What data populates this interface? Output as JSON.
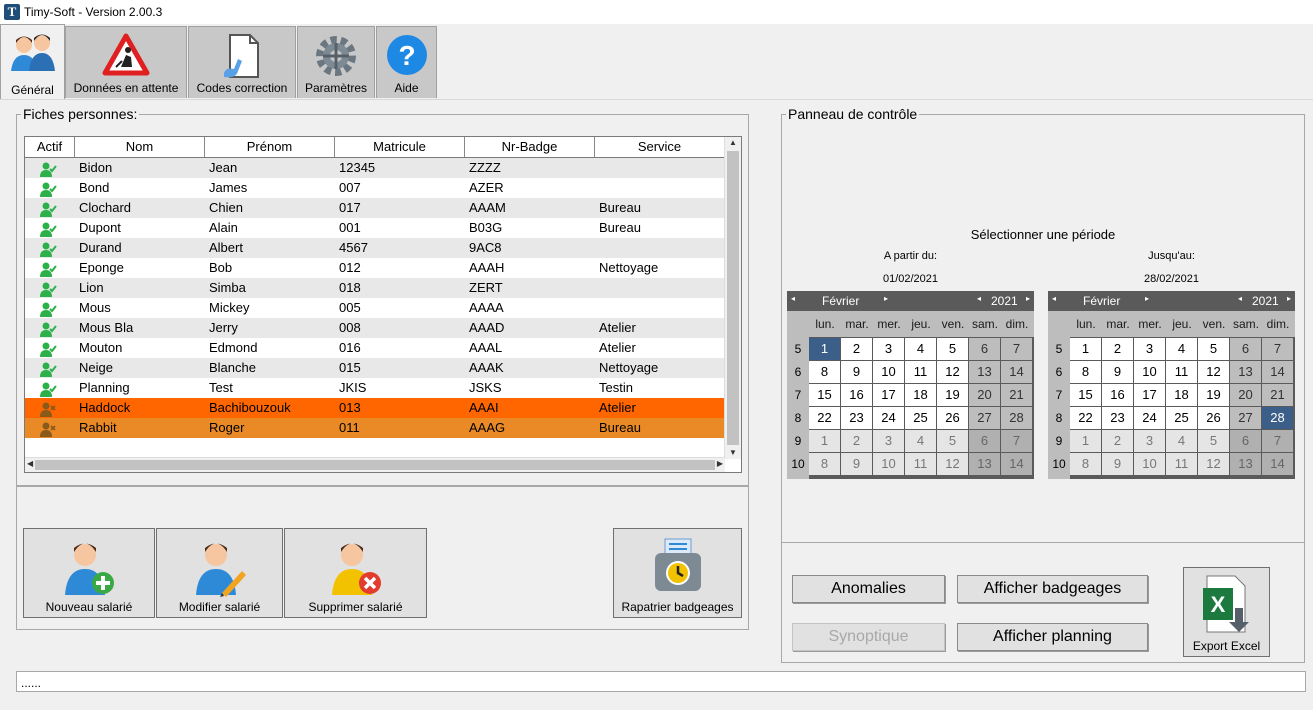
{
  "window": {
    "title": "Timy-Soft - Version 2.00.3"
  },
  "tabs": [
    {
      "label": "Général",
      "icon": "users-icon"
    },
    {
      "label": "Données en attente",
      "icon": "roadwork-warning-icon"
    },
    {
      "label": "Codes correction",
      "icon": "document-edit-icon"
    },
    {
      "label": "Paramètres",
      "icon": "gear-icon"
    },
    {
      "label": "Aide",
      "icon": "help-icon"
    }
  ],
  "persons": {
    "legend": "Fiches personnes:",
    "columns": [
      "Actif",
      "Nom",
      "Prénom",
      "Matricule",
      "Nr-Badge",
      "Service"
    ],
    "rows": [
      {
        "actif": true,
        "nom": "Bidon",
        "prenom": "Jean",
        "matricule": "12345",
        "badge": "ZZZZ",
        "service": ""
      },
      {
        "actif": true,
        "nom": "Bond",
        "prenom": "James",
        "matricule": "007",
        "badge": "AZER",
        "service": ""
      },
      {
        "actif": true,
        "nom": "Clochard",
        "prenom": "Chien",
        "matricule": "017",
        "badge": "AAAM",
        "service": "Bureau"
      },
      {
        "actif": true,
        "nom": "Dupont",
        "prenom": "Alain",
        "matricule": "001",
        "badge": "B03G",
        "service": "Bureau"
      },
      {
        "actif": true,
        "nom": "Durand",
        "prenom": "Albert",
        "matricule": "4567",
        "badge": "9AC8",
        "service": ""
      },
      {
        "actif": true,
        "nom": "Eponge",
        "prenom": "Bob",
        "matricule": "012",
        "badge": "AAAH",
        "service": "Nettoyage"
      },
      {
        "actif": true,
        "nom": "Lion",
        "prenom": "Simba",
        "matricule": "018",
        "badge": "ZERT",
        "service": ""
      },
      {
        "actif": true,
        "nom": "Mous",
        "prenom": "Mickey",
        "matricule": "005",
        "badge": "AAAA",
        "service": ""
      },
      {
        "actif": true,
        "nom": "Mous Bla",
        "prenom": "Jerry",
        "matricule": "008",
        "badge": "AAAD",
        "service": "Atelier"
      },
      {
        "actif": true,
        "nom": "Mouton",
        "prenom": "Edmond",
        "matricule": "016",
        "badge": "AAAL",
        "service": "Atelier"
      },
      {
        "actif": true,
        "nom": "Neige",
        "prenom": "Blanche",
        "matricule": "015",
        "badge": "AAAK",
        "service": "Nettoyage"
      },
      {
        "actif": true,
        "nom": "Planning",
        "prenom": "Test",
        "matricule": "JKIS",
        "badge": "JSKS",
        "service": "Testin"
      },
      {
        "actif": false,
        "nom": "Haddock",
        "prenom": "Bachibouzouk",
        "matricule": "013",
        "badge": "AAAI",
        "service": "Atelier",
        "highlight": "#ff6600"
      },
      {
        "actif": false,
        "nom": "Rabbit",
        "prenom": "Roger",
        "matricule": "011",
        "badge": "AAAG",
        "service": "Bureau",
        "highlight": "#ea8a26"
      }
    ]
  },
  "actions": {
    "new": "Nouveau salarié",
    "edit": "Modifier salarié",
    "delete": "Supprimer salarié",
    "fetch": "Rapatrier badgeages"
  },
  "control": {
    "legend": "Panneau de contrôle",
    "period_title": "Sélectionner une période",
    "from_label": "A partir du:",
    "from_value": "01/02/2021",
    "to_label": "Jusqu'au:",
    "to_value": "28/02/2021",
    "weekdays": [
      "lun.",
      "mar.",
      "mer.",
      "jeu.",
      "ven.",
      "sam.",
      "dim."
    ],
    "calendars": [
      {
        "month": "Février",
        "year": "2021",
        "selected_day": 1
      },
      {
        "month": "Février",
        "year": "2021",
        "selected_day": 28
      }
    ],
    "weeks": [
      5,
      6,
      7,
      8,
      9,
      10
    ],
    "buttons": {
      "anomalies": "Anomalies",
      "badgeages": "Afficher badgeages",
      "synoptique": "Synoptique",
      "planning": "Afficher planning",
      "excel": "Export Excel"
    }
  },
  "status": {
    "text": "......"
  },
  "colors": {
    "active_icon": "#2bb04a",
    "inactive_icon": "#8a5a1a",
    "selected_day": "#3c5f8a"
  }
}
